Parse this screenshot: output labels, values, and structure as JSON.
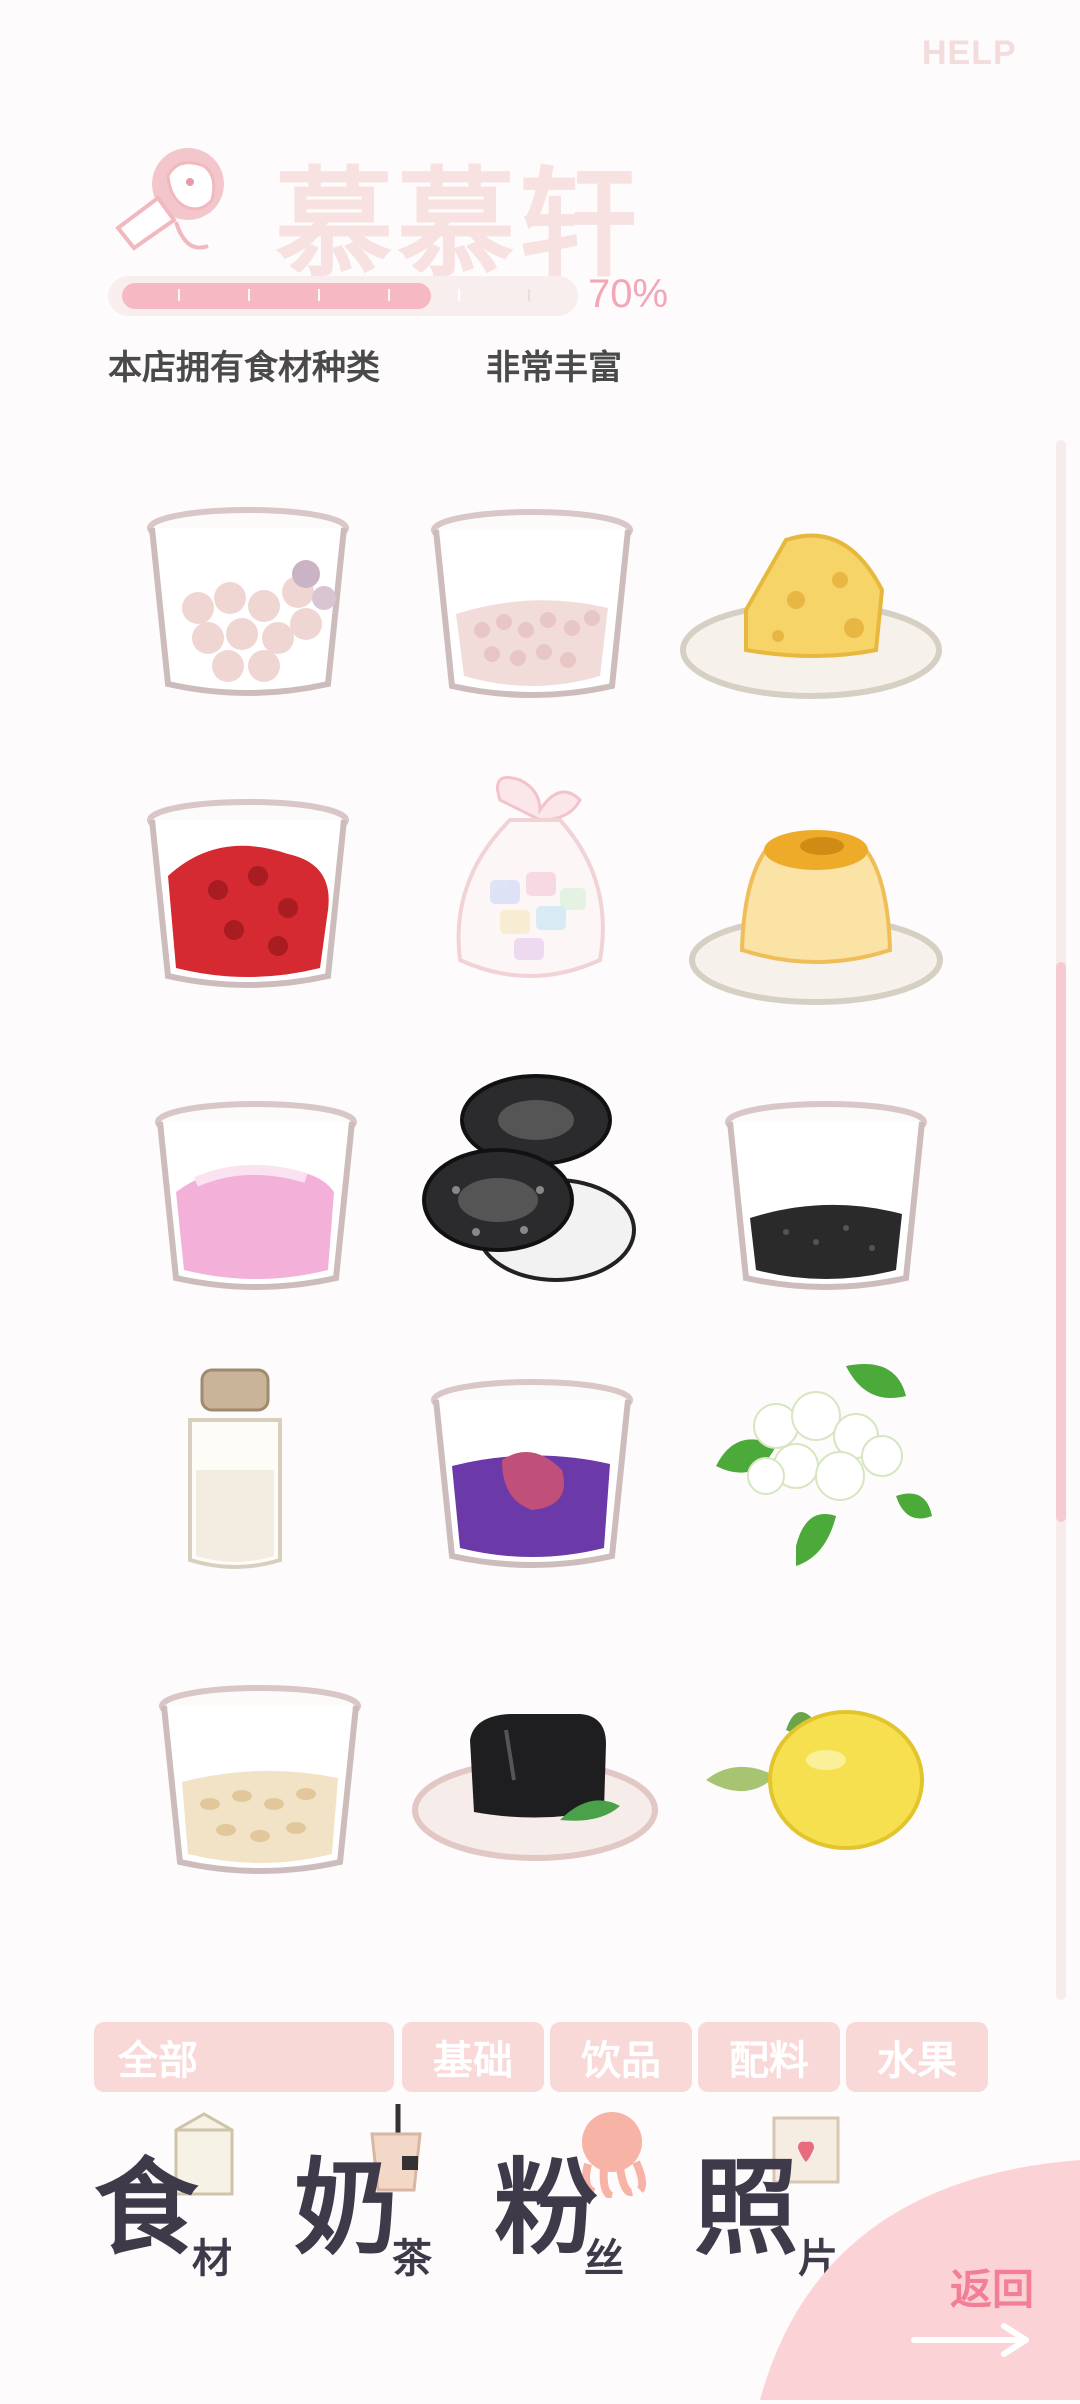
{
  "header": {
    "help_label": "HELP",
    "title": "慕慕轩",
    "progress_percent": 70,
    "progress_label": "70%",
    "stat_label": "本店拥有食材种类",
    "stat_value": "非常丰富"
  },
  "ingredients": [
    {
      "icon": "cup-tapioca-pearls-icon"
    },
    {
      "icon": "cup-small-pearls-icon"
    },
    {
      "icon": "cheese-plate-icon"
    },
    {
      "icon": "cup-red-beans-icon"
    },
    {
      "icon": "marshmallow-bag-icon"
    },
    {
      "icon": "pudding-plate-icon"
    },
    {
      "icon": "cup-pink-cream-icon"
    },
    {
      "icon": "oreo-cookies-icon"
    },
    {
      "icon": "cup-black-sesame-icon"
    },
    {
      "icon": "salt-shaker-icon"
    },
    {
      "icon": "cup-taro-icon"
    },
    {
      "icon": "jasmine-flowers-icon"
    },
    {
      "icon": "cup-oats-icon"
    },
    {
      "icon": "grass-jelly-plate-icon"
    },
    {
      "icon": "lemon-icon"
    }
  ],
  "tabs": [
    {
      "label": "全部"
    },
    {
      "label": "基础"
    },
    {
      "label": "饮品"
    },
    {
      "label": "配料"
    },
    {
      "label": "水果"
    }
  ],
  "bottom_nav": [
    {
      "main": "食",
      "sub": "材",
      "icon": "milk-carton-icon"
    },
    {
      "main": "奶",
      "sub": "茶",
      "icon": "milk-tea-cup-icon"
    },
    {
      "main": "粉",
      "sub": "丝",
      "icon": "octopus-icon"
    },
    {
      "main": "照",
      "sub": "片",
      "icon": "photo-icon"
    }
  ],
  "back_label": "返回",
  "colors": {
    "accent_pink": "#f6b9c4",
    "text_dark": "#3f3a4a",
    "tab_bg": "#f9d8d8",
    "back_red": "#f27f96"
  }
}
